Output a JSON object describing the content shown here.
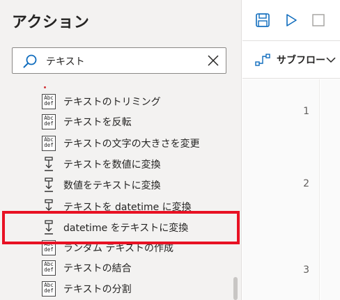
{
  "panel": {
    "title": "アクション",
    "search": {
      "value": "テキスト",
      "placeholder": ""
    }
  },
  "actions": [
    {
      "label": "テキストのトリミング",
      "icon": "abc-def-icon"
    },
    {
      "label": "テキストを反転",
      "icon": "abc-def-icon"
    },
    {
      "label": "テキストの文字の大きさを変更",
      "icon": "abc-def-icon"
    },
    {
      "label": "テキストを数値に変換",
      "icon": "convert-icon"
    },
    {
      "label": "数値をテキストに変換",
      "icon": "convert-icon"
    },
    {
      "label": "テキストを datetime に変換",
      "icon": "convert-icon"
    },
    {
      "label": "datetime をテキストに変換",
      "icon": "convert-icon"
    },
    {
      "label": "ランダム テキストの作成",
      "icon": "abc-def-icon"
    },
    {
      "label": "テキストの結合",
      "icon": "abc-def-icon"
    },
    {
      "label": "テキストの分割",
      "icon": "abc-def-icon"
    }
  ],
  "abc_icon_text": {
    "top": "Abc",
    "bottom": "def"
  },
  "toolbar": {
    "save": "save-icon",
    "run": "play-icon",
    "stop": "stop-icon"
  },
  "subflow": {
    "label": "サブフロー"
  },
  "editor": {
    "line_numbers": [
      "1",
      "2",
      "3"
    ]
  },
  "colors": {
    "accent": "#0f6cbd",
    "highlight": "#e81123",
    "panel_bg": "#f3f2f1"
  }
}
